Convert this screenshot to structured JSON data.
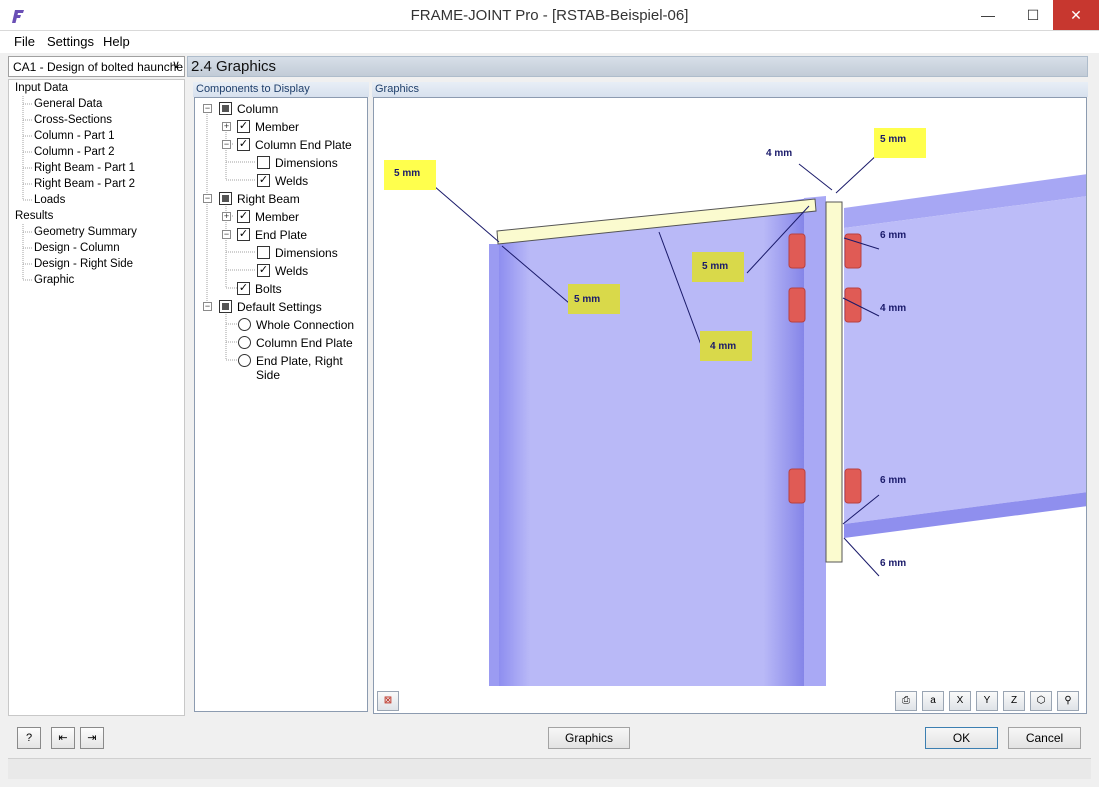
{
  "window": {
    "title": "FRAME-JOINT Pro - [RSTAB-Beispiel-06]",
    "minimize": "—",
    "maximize": "☐",
    "close": "✕"
  },
  "menu": {
    "file": "File",
    "settings": "Settings",
    "help": "Help"
  },
  "case_select": {
    "value": "CA1 - Design of bolted haunche",
    "arrow": "∨"
  },
  "nav": {
    "input_data": "Input Data",
    "general_data": "General Data",
    "cross_sections": "Cross-Sections",
    "column_part1": "Column - Part 1",
    "column_part2": "Column - Part 2",
    "right_beam_part1": "Right Beam - Part 1",
    "right_beam_part2": "Right Beam - Part 2",
    "loads": "Loads",
    "results": "Results",
    "geometry_summary": "Geometry Summary",
    "design_column": "Design - Column",
    "design_right_side": "Design - Right Side",
    "graphic": "Graphic"
  },
  "section_title": "2.4 Graphics",
  "components_label": "Components to Display",
  "graphics_label": "Graphics",
  "tree": {
    "column": "Column",
    "column_member": "Member",
    "column_end_plate": "Column End Plate",
    "column_dimensions": "Dimensions",
    "column_welds": "Welds",
    "right_beam": "Right Beam",
    "beam_member": "Member",
    "beam_end_plate": "End Plate",
    "beam_dimensions": "Dimensions",
    "beam_welds": "Welds",
    "bolts": "Bolts",
    "default_settings": "Default Settings",
    "whole_connection": "Whole Connection",
    "end_plate_right_side": "End Plate, Right Side"
  },
  "check_mark": "✓",
  "expand_plus": "+",
  "expand_minus": "−",
  "welds": {
    "w1": "5 mm",
    "w2": "5 mm",
    "w3": "4 mm",
    "w4": "5 mm",
    "w5": "5 mm",
    "w6": "4 mm",
    "w7": "6 mm",
    "w8": "4 mm",
    "w9": "6 mm",
    "w10": "6 mm"
  },
  "footer": {
    "graphics_button": "Graphics",
    "ok_button": "OK",
    "cancel_button": "Cancel"
  },
  "colors": {
    "steel": "#b9b9f7",
    "steel_dark": "#7d7de6",
    "plate": "#fbfbcf",
    "bolt": "#e05b55",
    "highlight": "#ffff4d",
    "highlight_dim": "#d9d94a"
  }
}
